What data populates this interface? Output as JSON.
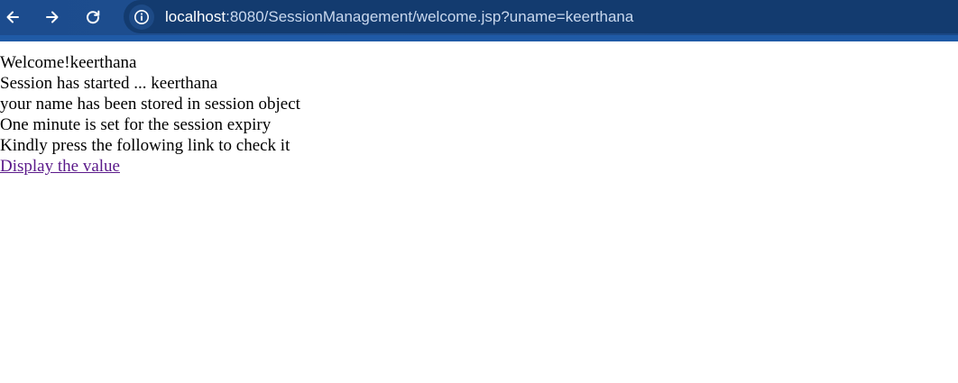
{
  "browser": {
    "url_host": "localhost",
    "url_rest": ":8080/SessionManagement/welcome.jsp?uname=keerthana",
    "icons": {
      "back": "back-arrow-icon",
      "forward": "forward-arrow-icon",
      "reload": "reload-icon",
      "site_info": "info-icon"
    },
    "colors": {
      "toolbar": "#1c4c8e",
      "address_bar": "#133b6f",
      "accent_strip": "#1f5aa6"
    }
  },
  "page": {
    "lines": [
      "Welcome!keerthana",
      "Session has started ... keerthana",
      "your name has been stored in session object",
      "One minute is set for the session expiry",
      "Kindly press the following link to check it"
    ],
    "link_label": "Display the value",
    "link_color": "#5b1a8a"
  }
}
